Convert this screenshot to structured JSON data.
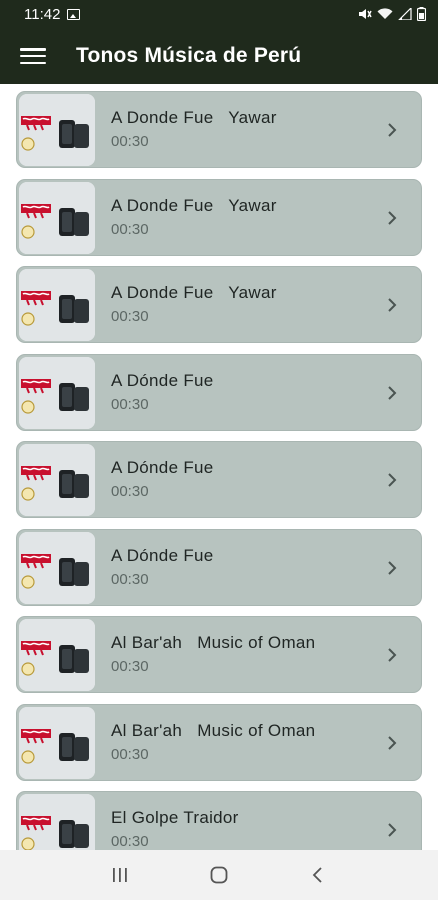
{
  "status_bar": {
    "time": "11:42"
  },
  "app_bar": {
    "title": "Tonos Música de Perú"
  },
  "colors": {
    "app_bar_bg": "#1f2a1c",
    "item_bg": "#b7c3bf",
    "nav_bg": "#f2f2f2"
  },
  "items": [
    {
      "title": "A Donde Fue   Yawar",
      "duration": "00:30"
    },
    {
      "title": "A Donde Fue   Yawar",
      "duration": "00:30"
    },
    {
      "title": "A Donde Fue   Yawar",
      "duration": "00:30"
    },
    {
      "title": "A Dónde Fue",
      "duration": "00:30"
    },
    {
      "title": "A Dónde Fue",
      "duration": "00:30"
    },
    {
      "title": "A Dónde Fue",
      "duration": "00:30"
    },
    {
      "title": "Al Bar'ah   Music of Oman",
      "duration": "00:30"
    },
    {
      "title": "Al Bar'ah   Music of Oman",
      "duration": "00:30"
    },
    {
      "title": "El Golpe Traidor",
      "duration": "00:30"
    }
  ],
  "icons": {
    "menu": "hamburger-menu-icon",
    "chevron": "chevron-right-icon",
    "nav_recents": "recents-icon",
    "nav_home": "home-icon",
    "nav_back": "back-icon"
  }
}
